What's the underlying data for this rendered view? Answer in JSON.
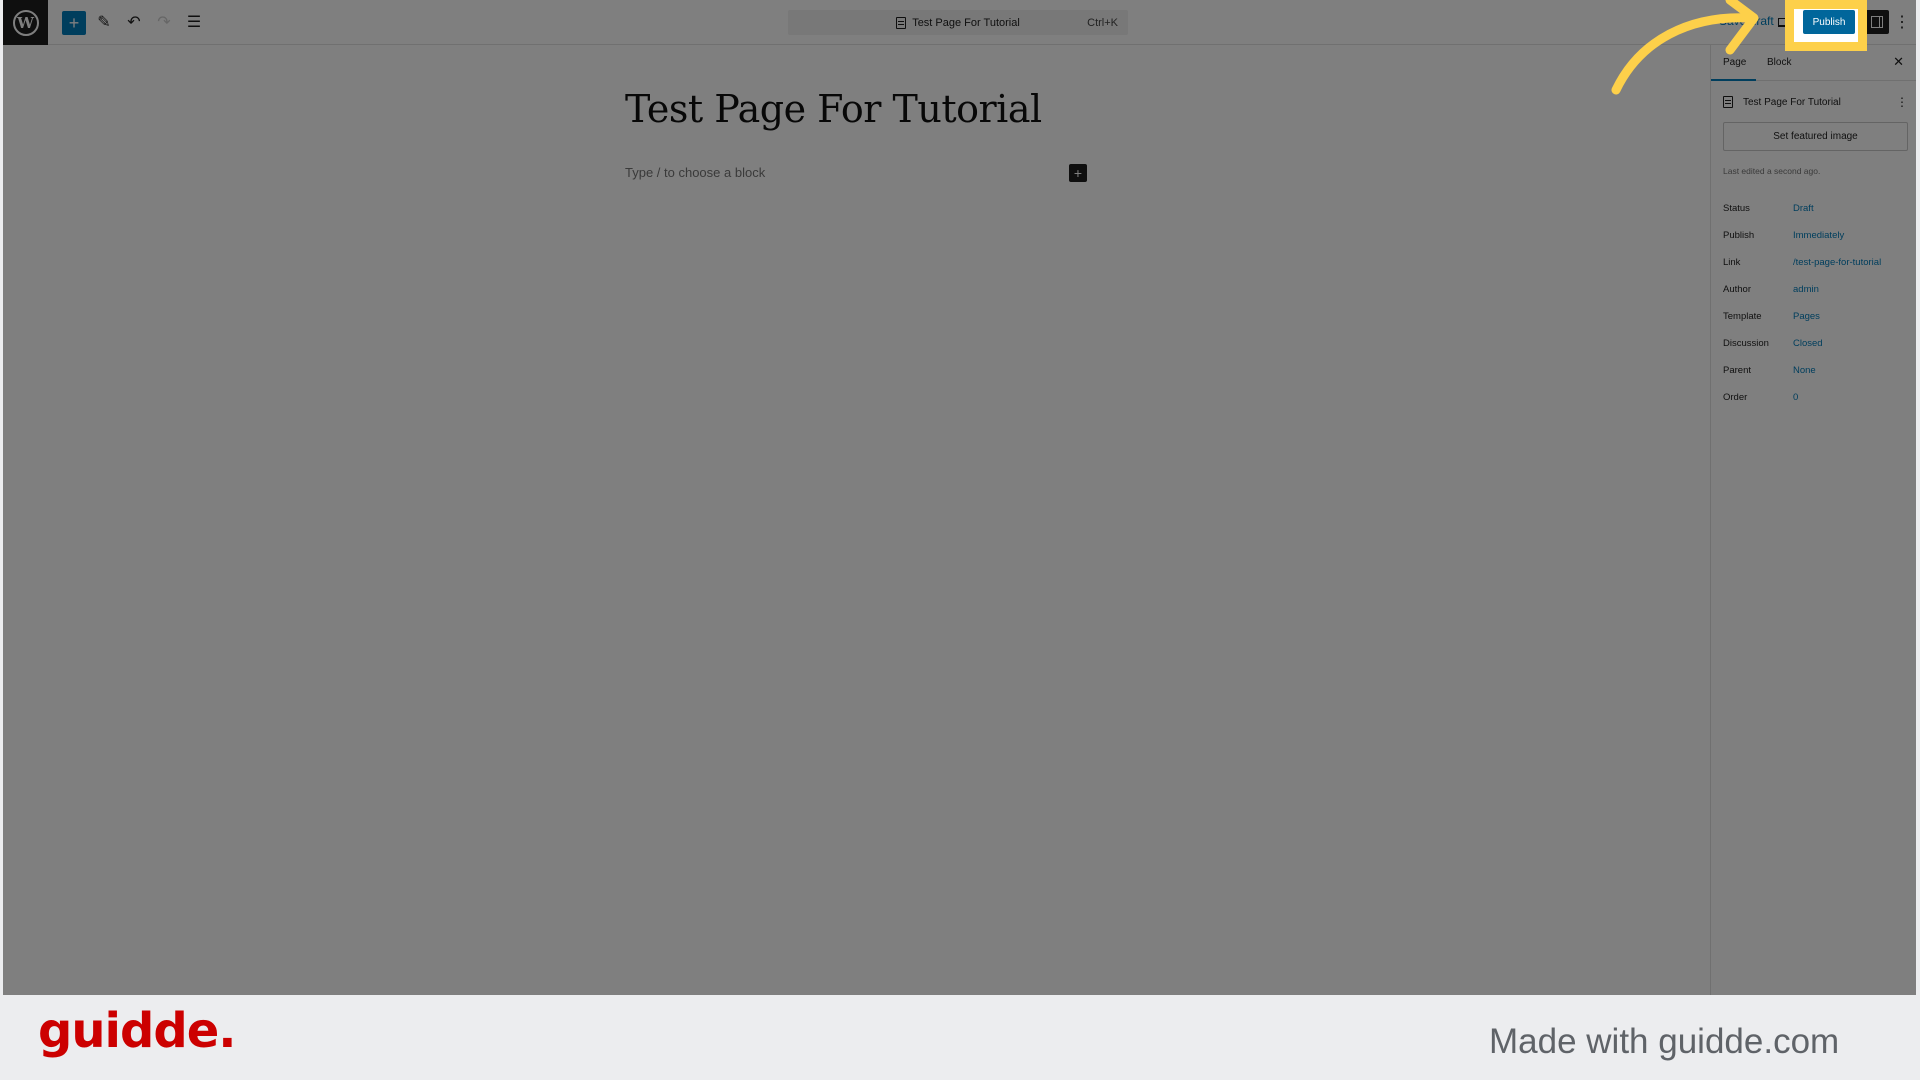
{
  "toolbar": {
    "add_block_icon": "+",
    "tools_icon": "✎",
    "undo_icon": "↶",
    "redo_icon": "↷",
    "list_view_icon": "☰",
    "command_title": "Test Page For Tutorial",
    "command_shortcut": "Ctrl+K",
    "save_draft": "Save draft",
    "publish": "Publish",
    "more_icon": "⋮"
  },
  "editor": {
    "title": "Test Page For Tutorial",
    "block_placeholder": "Type / to choose a block",
    "inserter_icon": "+"
  },
  "sidebar": {
    "tabs": [
      {
        "label": "Page",
        "active": true
      },
      {
        "label": "Block",
        "active": false
      }
    ],
    "close_icon": "✕",
    "document_title": "Test Page For Tutorial",
    "kebab_icon": "⋮",
    "featured_image_button": "Set featured image",
    "last_edited": "Last edited a second ago.",
    "meta": [
      {
        "label": "Status",
        "value": "Draft"
      },
      {
        "label": "Publish",
        "value": "Immediately"
      },
      {
        "label": "Link",
        "value": "/test-page-for-tutorial"
      },
      {
        "label": "Author",
        "value": "admin"
      },
      {
        "label": "Template",
        "value": "Pages"
      },
      {
        "label": "Discussion",
        "value": "Closed"
      },
      {
        "label": "Parent",
        "value": "None"
      },
      {
        "label": "Order",
        "value": "0"
      }
    ]
  },
  "annotation": {
    "highlight_color": "#fdd04a",
    "target": "Publish"
  },
  "footer": {
    "logo": "guidde.",
    "tagline": "Made with guidde.com",
    "logo_color": "#cc0000"
  }
}
